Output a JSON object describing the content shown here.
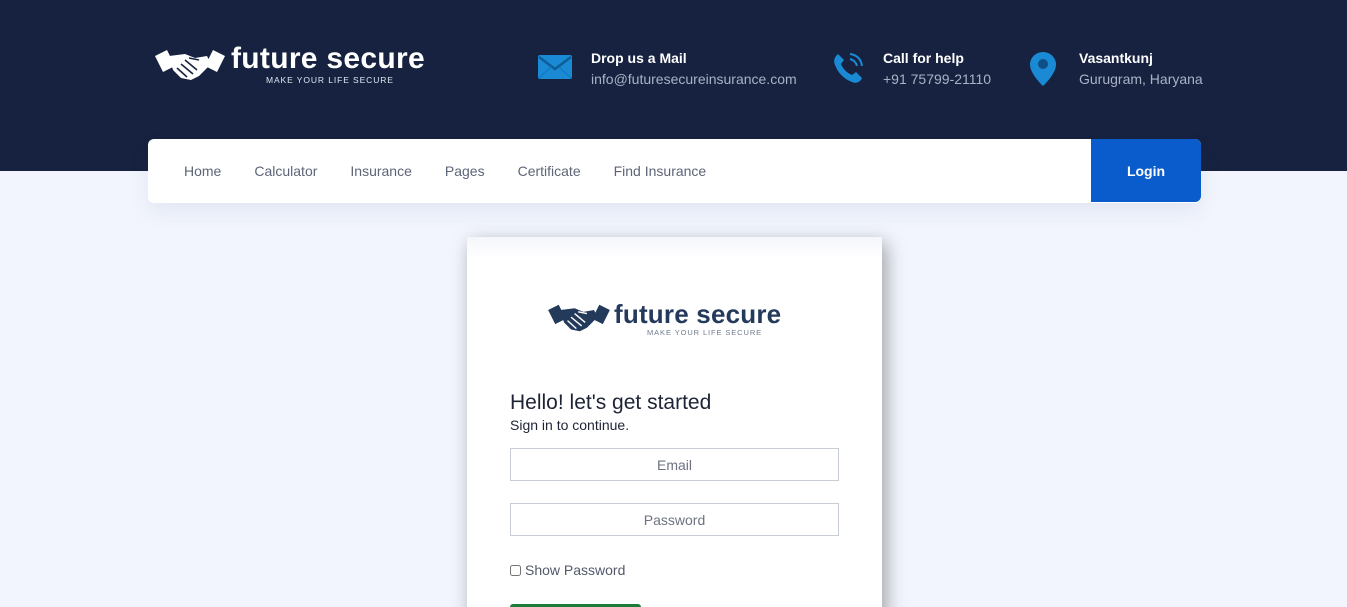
{
  "brand": {
    "name": "future secure",
    "tagline": "MAKE YOUR LIFE SECURE"
  },
  "contacts": [
    {
      "title": "Drop us a Mail",
      "value": "info@futuresecureinsurance.com",
      "icon": "mail-icon"
    },
    {
      "title": "Call for help",
      "value": "+91 75799-21110",
      "icon": "phone-icon"
    },
    {
      "title": "Vasantkunj",
      "value": "Gurugram, Haryana",
      "icon": "location-pin-icon"
    }
  ],
  "nav": {
    "items": [
      "Home",
      "Calculator",
      "Insurance",
      "Pages",
      "Certificate",
      "Find Insurance"
    ],
    "login_label": "Login"
  },
  "login_form": {
    "heading": "Hello! let's get started",
    "subheading": "Sign in to continue.",
    "email_placeholder": "Email",
    "password_placeholder": "Password",
    "show_password_label": "Show Password"
  },
  "colors": {
    "header_bg": "#16223f",
    "accent_blue": "#0a5ccc",
    "page_bg": "#f2f5fd",
    "submit_green": "#1e7c3a"
  }
}
